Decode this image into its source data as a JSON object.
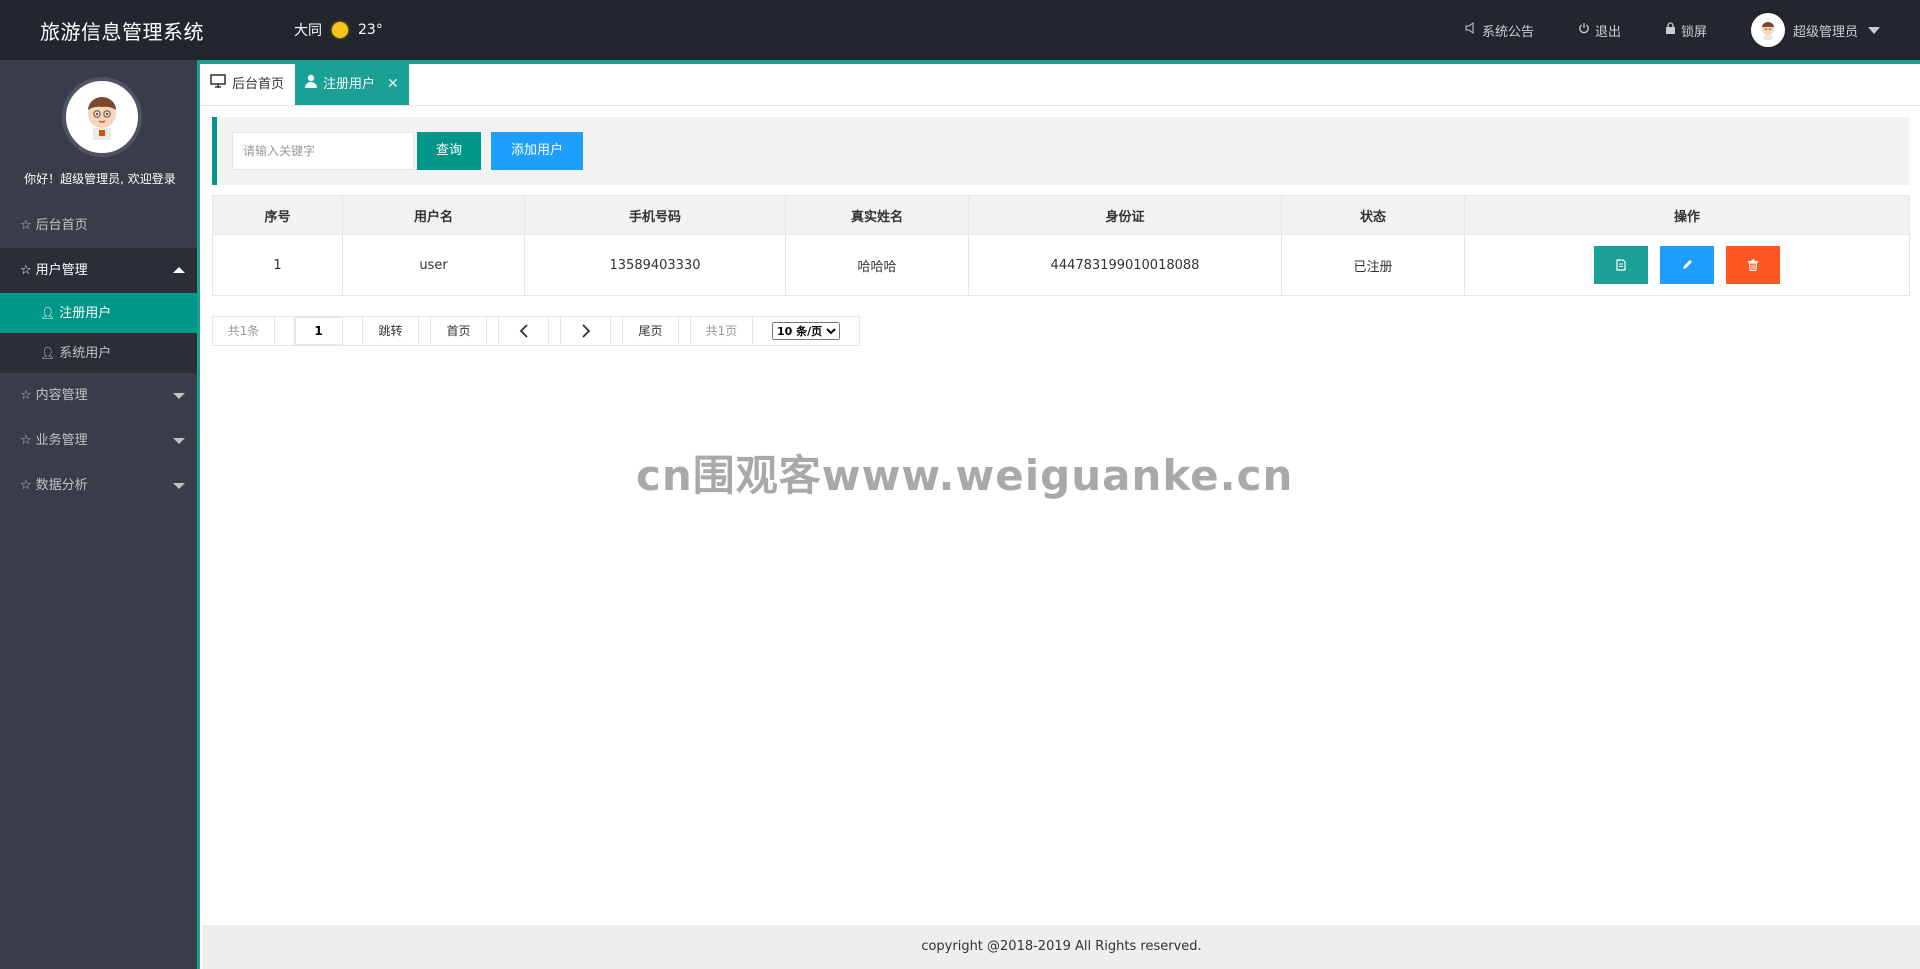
{
  "header": {
    "title": "旅游信息管理系统",
    "city": "大同",
    "temperature": "23°",
    "notice_label": "系统公告",
    "logout_label": "退出",
    "lock_label": "锁屏",
    "user_name": "超级管理员"
  },
  "sidebar": {
    "welcome": "你好！超级管理员, 欢迎登录",
    "items": [
      {
        "label": "后台首页"
      },
      {
        "label": "用户管理"
      },
      {
        "label": "注册用户"
      },
      {
        "label": "系统用户"
      },
      {
        "label": "内容管理"
      },
      {
        "label": "业务管理"
      },
      {
        "label": "数据分析"
      }
    ]
  },
  "tabs": [
    {
      "label": "后台首页"
    },
    {
      "label": "注册用户"
    }
  ],
  "search": {
    "placeholder": "请输入关键字",
    "query_label": "查询",
    "add_label": "添加用户"
  },
  "table": {
    "columns": [
      "序号",
      "用户名",
      "手机号码",
      "真实姓名",
      "身份证",
      "状态",
      "操作"
    ],
    "rows": [
      {
        "index": "1",
        "username": "user",
        "phone": "13589403330",
        "realname": "哈哈哈",
        "idcard": "444783199010018088",
        "status": "已注册"
      }
    ]
  },
  "pager": {
    "total": "共1条",
    "page_value": "1",
    "jump_label": "跳转",
    "first_label": "首页",
    "last_label": "尾页",
    "pages": "共1页",
    "page_size": "10 条/页"
  },
  "watermark": "cn围观客www.weiguanke.cn",
  "footer": "copyright @2018-2019 All Rights reserved.",
  "colors": {
    "header_bg": "#23262e",
    "sidebar_bg": "#393d49",
    "accent": "#009688",
    "blue": "#1e9fff",
    "orange": "#ff5722"
  }
}
